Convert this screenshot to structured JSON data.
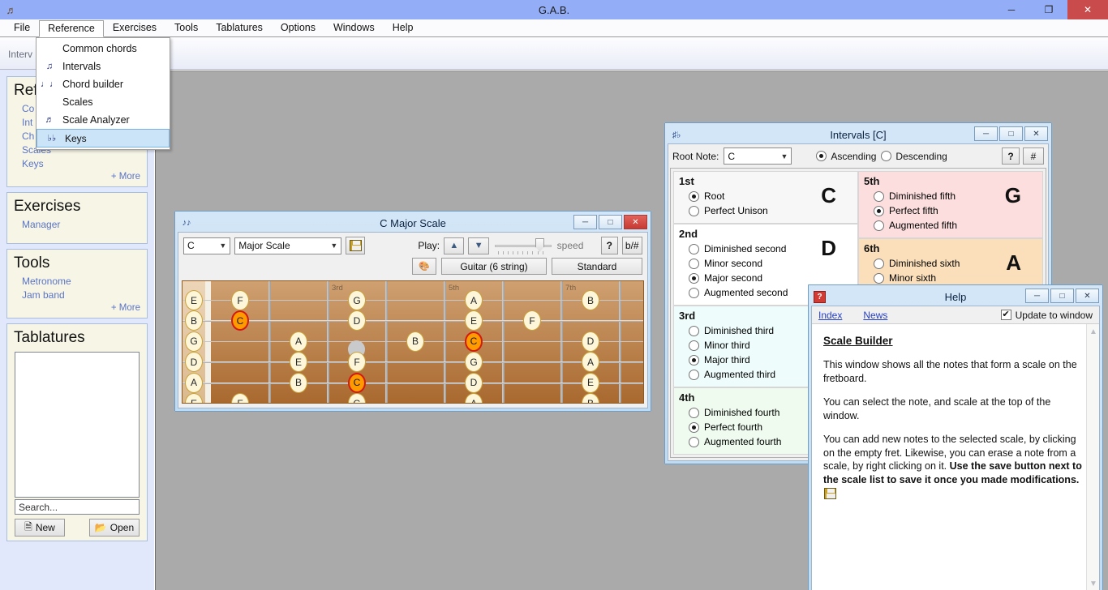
{
  "app": {
    "title": "G.A.B.",
    "icon": "guitar-head-icon",
    "window_controls": {
      "minimize": "─",
      "maximize": "❐",
      "close": "✕"
    }
  },
  "menubar": {
    "items": [
      {
        "label": "File",
        "open": false
      },
      {
        "label": "Reference",
        "open": true
      },
      {
        "label": "Exercises",
        "open": false
      },
      {
        "label": "Tools",
        "open": false
      },
      {
        "label": "Tablatures",
        "open": false
      },
      {
        "label": "Options",
        "open": false
      },
      {
        "label": "Windows",
        "open": false
      },
      {
        "label": "Help",
        "open": false
      }
    ]
  },
  "reference_menu": {
    "items": [
      {
        "label": "Common chords",
        "icon": "",
        "selected": false
      },
      {
        "label": "Intervals",
        "icon": "intervals-notes-icon",
        "selected": false
      },
      {
        "label": "Chord builder",
        "icon": "chord-notes-icon",
        "selected": false
      },
      {
        "label": "Scales",
        "icon": "",
        "selected": false
      },
      {
        "label": "Scale Analyzer",
        "icon": "scale-notes-icon",
        "selected": false
      },
      {
        "label": "Keys",
        "icon": "flats-key-icon",
        "selected": true
      }
    ]
  },
  "tabstrip": {
    "label": "Interv"
  },
  "sidebar": {
    "panels": [
      {
        "title": "Refe",
        "links": [
          "Co",
          "Int",
          "Ch",
          "Scales",
          "Keys"
        ],
        "more": "+ More"
      },
      {
        "title": "Exercises",
        "links": [
          "Manager"
        ],
        "more": ""
      },
      {
        "title": "Tools",
        "links": [
          "Metronome",
          "Jam band"
        ],
        "more": "+ More"
      }
    ],
    "tablatures": {
      "title": "Tablatures",
      "search_placeholder": "Search...",
      "new_label": "New",
      "open_label": "Open",
      "new_icon": "document-icon",
      "open_icon": "folder-open-icon"
    }
  },
  "scale_window": {
    "title": "C Major Scale",
    "icon": "fretboard-icon",
    "root_note": "C",
    "scale_name": "Major Scale",
    "save_icon": "floppy-disk-icon",
    "play_label": "Play:",
    "up_icon": "triangle-up-icon",
    "down_icon": "triangle-down-icon",
    "speed_label": "speed",
    "help_btn": "?",
    "accidental_btn": "b/#",
    "palette_icon": "color-palette-icon",
    "instrument": "Guitar (6 string)",
    "tuning": "Standard",
    "controls": {
      "minimize": "─",
      "restore": "□",
      "close": "✕"
    },
    "fret_labels": [
      {
        "text": "3rd",
        "fret": 3
      },
      {
        "text": "5th",
        "fret": 5
      },
      {
        "text": "7th",
        "fret": 7
      }
    ],
    "strings": [
      "E",
      "B",
      "G",
      "D",
      "A",
      "E"
    ],
    "notes": [
      {
        "string": 0,
        "fret": 0,
        "label": "E",
        "root": false
      },
      {
        "string": 1,
        "fret": 0,
        "label": "B",
        "root": false
      },
      {
        "string": 2,
        "fret": 0,
        "label": "G",
        "root": false
      },
      {
        "string": 3,
        "fret": 0,
        "label": "D",
        "root": false
      },
      {
        "string": 4,
        "fret": 0,
        "label": "A",
        "root": false
      },
      {
        "string": 5,
        "fret": 0,
        "label": "E",
        "root": false
      },
      {
        "string": 0,
        "fret": 1,
        "label": "F",
        "root": false
      },
      {
        "string": 1,
        "fret": 1,
        "label": "C",
        "root": true
      },
      {
        "string": 5,
        "fret": 1,
        "label": "F",
        "root": false
      },
      {
        "string": 2,
        "fret": 2,
        "label": "A",
        "root": false
      },
      {
        "string": 3,
        "fret": 2,
        "label": "E",
        "root": false
      },
      {
        "string": 4,
        "fret": 2,
        "label": "B",
        "root": false
      },
      {
        "string": 0,
        "fret": 3,
        "label": "G",
        "root": false
      },
      {
        "string": 1,
        "fret": 3,
        "label": "D",
        "root": false
      },
      {
        "string": 3,
        "fret": 3,
        "label": "F",
        "root": false
      },
      {
        "string": 4,
        "fret": 3,
        "label": "C",
        "root": true
      },
      {
        "string": 5,
        "fret": 3,
        "label": "G",
        "root": false
      },
      {
        "string": 2,
        "fret": 4,
        "label": "B",
        "root": false
      },
      {
        "string": 0,
        "fret": 5,
        "label": "A",
        "root": false
      },
      {
        "string": 1,
        "fret": 5,
        "label": "E",
        "root": false
      },
      {
        "string": 2,
        "fret": 5,
        "label": "C",
        "root": true
      },
      {
        "string": 3,
        "fret": 5,
        "label": "G",
        "root": false
      },
      {
        "string": 4,
        "fret": 5,
        "label": "D",
        "root": false
      },
      {
        "string": 5,
        "fret": 5,
        "label": "A",
        "root": false
      },
      {
        "string": 1,
        "fret": 6,
        "label": "F",
        "root": false
      },
      {
        "string": 0,
        "fret": 7,
        "label": "B",
        "root": false
      },
      {
        "string": 2,
        "fret": 7,
        "label": "D",
        "root": false
      },
      {
        "string": 3,
        "fret": 7,
        "label": "A",
        "root": false
      },
      {
        "string": 4,
        "fret": 7,
        "label": "E",
        "root": false
      },
      {
        "string": 5,
        "fret": 7,
        "label": "B",
        "root": false
      }
    ],
    "inlays": [
      {
        "string": 2,
        "fret": 3
      },
      {
        "string": 2,
        "fret": 5
      },
      {
        "string": 2,
        "fret": 7
      }
    ]
  },
  "intervals_window": {
    "title": "Intervals [C]",
    "icon": "intervals-notes-icon",
    "root_note_label": "Root Note:",
    "root_note_value": "C",
    "direction_options": [
      {
        "label": "Ascending",
        "selected": true
      },
      {
        "label": "Descending",
        "selected": false
      }
    ],
    "help_btn": "?",
    "sharp_btn": "#",
    "controls": {
      "minimize": "─",
      "restore": "□",
      "close": "✕"
    },
    "groups_left": [
      {
        "degree": "1st",
        "note": "C",
        "bg": "#f7f7f7",
        "options": [
          {
            "label": "Root",
            "selected": true
          },
          {
            "label": "Perfect Unison",
            "selected": false
          }
        ]
      },
      {
        "degree": "2nd",
        "note": "D",
        "bg": "#ffffff",
        "options": [
          {
            "label": "Diminished second",
            "selected": false
          },
          {
            "label": "Minor second",
            "selected": false
          },
          {
            "label": "Major second",
            "selected": true
          },
          {
            "label": "Augmented second",
            "selected": false
          }
        ]
      },
      {
        "degree": "3rd",
        "note": "",
        "bg": "#eefcfb",
        "options": [
          {
            "label": "Diminished third",
            "selected": false
          },
          {
            "label": "Minor third",
            "selected": false
          },
          {
            "label": "Major third",
            "selected": true
          },
          {
            "label": "Augmented third",
            "selected": false
          }
        ]
      },
      {
        "degree": "4th",
        "note": "",
        "bg": "#eefbee",
        "options": [
          {
            "label": "Diminished fourth",
            "selected": false
          },
          {
            "label": "Perfect fourth",
            "selected": true
          },
          {
            "label": "Augmented fourth",
            "selected": false
          }
        ]
      }
    ],
    "groups_right": [
      {
        "degree": "5th",
        "note": "G",
        "bg": "#fbdedd",
        "options": [
          {
            "label": "Diminished fifth",
            "selected": false
          },
          {
            "label": "Perfect fifth",
            "selected": true
          },
          {
            "label": "Augmented fifth",
            "selected": false
          }
        ]
      },
      {
        "degree": "6th",
        "note": "A",
        "bg": "#fbdfbb",
        "options": [
          {
            "label": "Diminished sixth",
            "selected": false
          },
          {
            "label": "Minor sixth",
            "selected": false
          }
        ]
      }
    ]
  },
  "help_window": {
    "title": "Help",
    "icon": "help-question-icon",
    "index_label": "Index",
    "news_label": "News",
    "update_label": "Update to window",
    "update_checked": true,
    "controls": {
      "minimize": "─",
      "restore": "□",
      "close": "✕"
    },
    "heading": "Scale Builder",
    "para1": "This window shows all the notes that form a scale on the fretboard.",
    "para2": "You can select the note, and scale at the top of the window.",
    "para3_normal": "You can add new notes to the selected scale, by clicking on the empty fret. Likewise, you can erase a note from a scale, by right clicking on it. ",
    "para3_bold": "Use the save button next to the scale list to save it once you made modifications.",
    "scroll_up_icon": "chevron-up-icon",
    "scroll_down_icon": "chevron-down-icon"
  }
}
